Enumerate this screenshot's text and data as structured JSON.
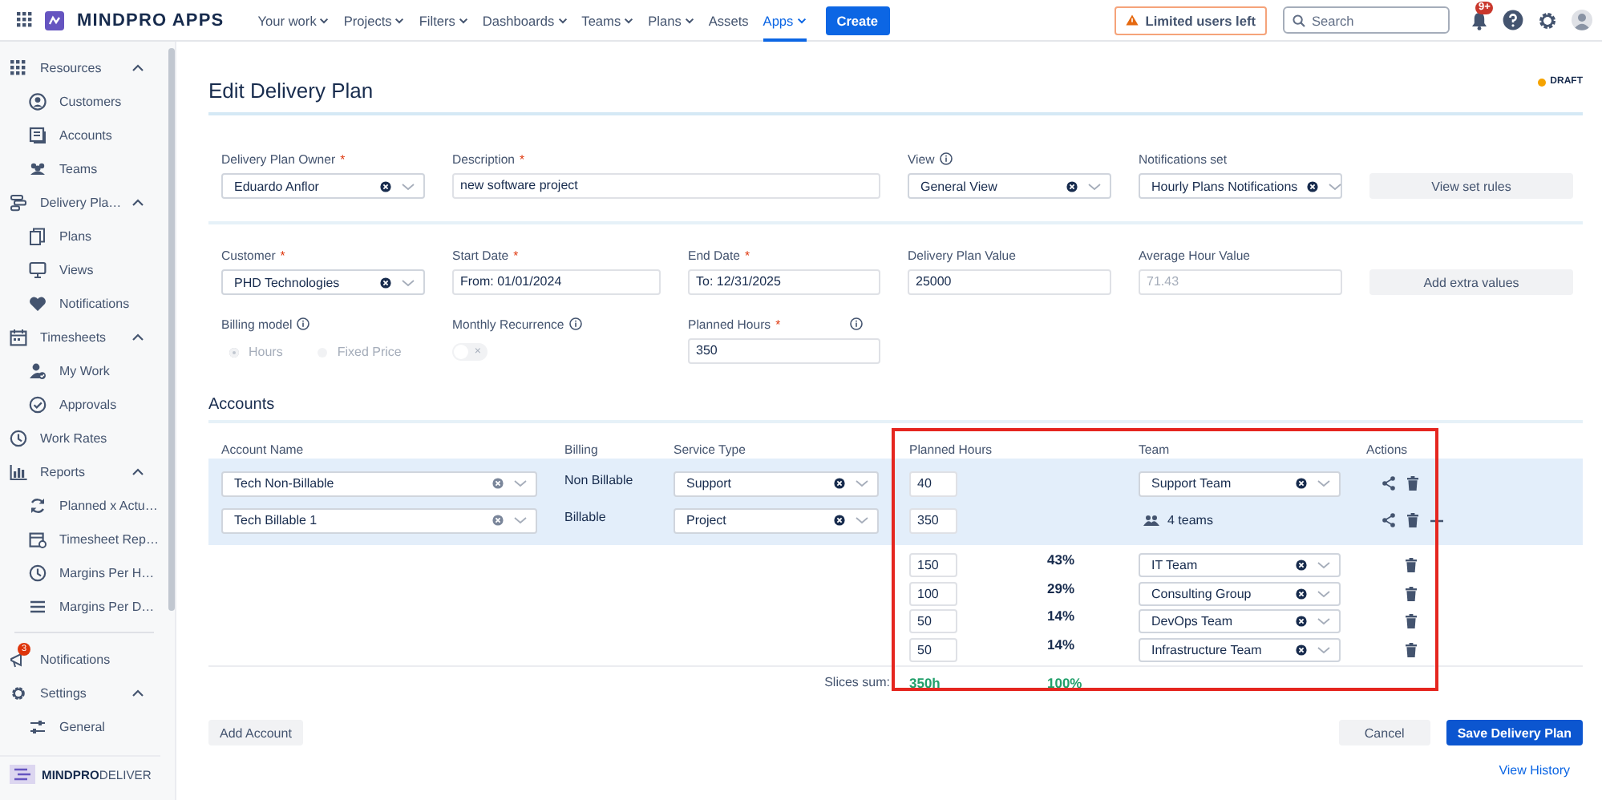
{
  "topbar": {
    "logo": "MINDPRO APPS",
    "menus": [
      {
        "label": "Your work",
        "dropdown": true,
        "selected": false
      },
      {
        "label": "Projects",
        "dropdown": true,
        "selected": false
      },
      {
        "label": "Filters",
        "dropdown": true,
        "selected": false
      },
      {
        "label": "Dashboards",
        "dropdown": true,
        "selected": false
      },
      {
        "label": "Teams",
        "dropdown": true,
        "selected": false
      },
      {
        "label": "Plans",
        "dropdown": true,
        "selected": false
      },
      {
        "label": "Assets",
        "dropdown": false,
        "selected": false
      },
      {
        "label": "Apps",
        "dropdown": true,
        "selected": true
      }
    ],
    "create": "Create",
    "alert": "Limited users left",
    "search_placeholder": "Search",
    "notification_badge": "9+"
  },
  "sidebar": {
    "items": [
      {
        "kind": "section",
        "label": "Resources",
        "expanded": true,
        "children": [
          {
            "label": "Customers"
          },
          {
            "label": "Accounts"
          },
          {
            "label": "Teams"
          }
        ]
      },
      {
        "kind": "section",
        "label": "Delivery Pla…",
        "expanded": true,
        "children": [
          {
            "label": "Plans"
          },
          {
            "label": "Views"
          },
          {
            "label": "Notifications"
          }
        ]
      },
      {
        "kind": "section",
        "label": "Timesheets",
        "expanded": true,
        "children": [
          {
            "label": "My Work"
          },
          {
            "label": "Approvals"
          }
        ]
      },
      {
        "kind": "link",
        "label": "Work Rates"
      },
      {
        "kind": "section",
        "label": "Reports",
        "expanded": true,
        "children": [
          {
            "label": "Planned x Actu…"
          },
          {
            "label": "Timesheet Rep…"
          },
          {
            "label": "Margins Per H…"
          },
          {
            "label": "Margins Per D…"
          }
        ]
      },
      {
        "kind": "divider"
      },
      {
        "kind": "link",
        "label": "Notifications",
        "badge": "3"
      },
      {
        "kind": "section",
        "label": "Settings",
        "expanded": true,
        "children": [
          {
            "label": "General"
          }
        ]
      }
    ],
    "footer_logo": "MINDPRO",
    "footer_logo_light": "DELIVER"
  },
  "page": {
    "title": "Edit Delivery Plan",
    "status": "DRAFT"
  },
  "form": {
    "groups": [
      {
        "fields": [
          {
            "kind": "select",
            "label": "Delivery Plan Owner",
            "required_mark": "*",
            "info": false,
            "value": "Eduardo Anflor"
          },
          {
            "kind": "text",
            "label": "Description",
            "required_mark": "*",
            "info": false,
            "value": "new software project",
            "disabled": false
          },
          {
            "kind": "select",
            "label": "View",
            "info": true,
            "value": "General View"
          },
          {
            "kind": "select",
            "label": "Notifications set",
            "info": false,
            "value": "Hourly Plans Notifications"
          },
          {
            "kind": "button",
            "label": "View set rules"
          }
        ]
      },
      {
        "fields": [
          {
            "kind": "select",
            "label": "Customer",
            "required_mark": "*",
            "info": false,
            "value": "PHD Technologies"
          },
          {
            "kind": "text",
            "label": "Start Date",
            "required_mark": "*",
            "info": false,
            "value": "From: 01/01/2024",
            "disabled": false
          },
          {
            "kind": "text",
            "label": "End Date",
            "required_mark": "*",
            "info": false,
            "value": "To: 12/31/2025",
            "disabled": false
          },
          {
            "kind": "text",
            "label": "Delivery Plan Value",
            "info": false,
            "value": "25000",
            "disabled": false
          },
          {
            "kind": "text",
            "label": "Average Hour Value",
            "info": false,
            "value": "71.43",
            "disabled": true
          },
          {
            "kind": "button",
            "label": "Add extra values"
          },
          {
            "kind": "radio",
            "label": "Billing model",
            "info": true,
            "disabled": true,
            "options": [
              {
                "label": "Hours",
                "selected": true
              },
              {
                "label": "Fixed Price",
                "selected": false
              }
            ]
          },
          {
            "kind": "toggle",
            "label": "Monthly Recurrence",
            "info": true,
            "on": false,
            "symbol": "×"
          },
          {
            "kind": "text",
            "label": "Planned Hours",
            "required_mark": "*",
            "info": true,
            "value": "350",
            "disabled": false
          }
        ]
      }
    ]
  },
  "accounts": {
    "title": "Accounts",
    "columns": [
      "Account Name",
      "Billing",
      "Service Type",
      "Planned Hours",
      "Team",
      "Actions"
    ],
    "rows": [
      {
        "kind": "account",
        "name": "Tech Non-Billable",
        "billing": "Non Billable",
        "service_type": "Support",
        "hours": "40",
        "team": "Support Team",
        "can_split": false
      },
      {
        "kind": "account",
        "name": "Tech Billable 1",
        "billing": "Billable",
        "service_type": "Project",
        "hours": "350",
        "teams_summary": "4 teams",
        "can_split": true
      },
      {
        "kind": "slice",
        "hours": "150",
        "percent": "43%",
        "team": "IT Team"
      },
      {
        "kind": "slice",
        "hours": "100",
        "percent": "29%",
        "team": "Consulting Group"
      },
      {
        "kind": "slice",
        "hours": "50",
        "percent": "14%",
        "team": "DevOps Team"
      },
      {
        "kind": "slice",
        "hours": "50",
        "percent": "14%",
        "team": "Infrastructure Team"
      }
    ],
    "sum": {
      "label": "Slices sum:",
      "hours": "350h",
      "percent": "100%"
    }
  },
  "footer": {
    "add": "Add Account",
    "cancel": "Cancel",
    "save": "Save Delivery Plan",
    "history": "View History"
  }
}
